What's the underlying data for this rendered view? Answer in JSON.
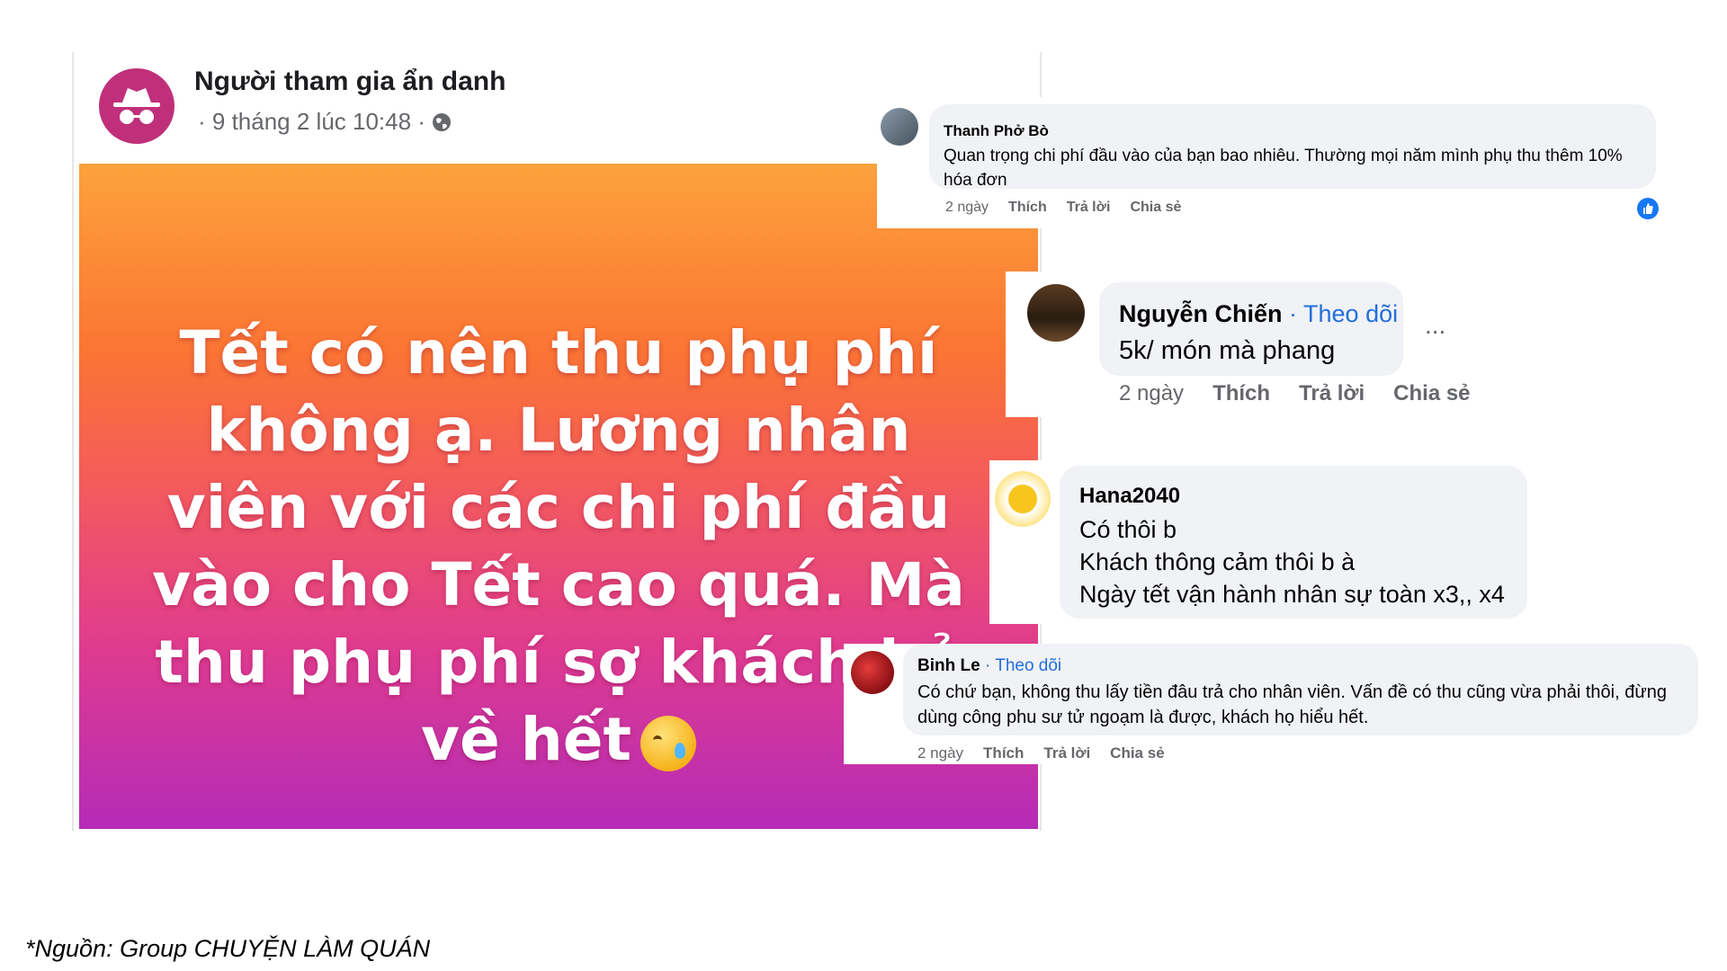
{
  "post": {
    "author": "Người tham gia ẩn danh",
    "meta": "· 9 tháng 2 lúc 10:48 ·",
    "text": "Tết có nên thu phụ phí không ạ. Lương nhân viên với các chi phí đầu vào cho Tết cao quá. Mà thu phụ phí sợ khách bỏ về hết",
    "gradient_colors": [
      "#fca23c",
      "#fb7533",
      "#f45b5b",
      "#e03c8e",
      "#b52bb7"
    ]
  },
  "comments": [
    {
      "name": "Thanh Phở Bò",
      "text": "Quan trọng chi phí đầu vào của bạn bao nhiêu. Thường mọi năm mình phụ thu thêm 10% hóa đơn",
      "time": "2 ngày",
      "like": "Thích",
      "reply": "Trả lời",
      "share": "Chia sẻ"
    },
    {
      "name": "Nguyễn Chiến",
      "follow": "· Theo dõi",
      "text": "5k/ món mà phang",
      "more": "...",
      "time": "2 ngày",
      "like": "Thích",
      "reply": "Trả lời",
      "share": "Chia sẻ"
    },
    {
      "name": "Hana2040",
      "lines": [
        "Có thôi b",
        "Khách thông cảm thôi b à",
        "Ngày tết vận hành nhân sự toàn x3,, x4"
      ]
    },
    {
      "name": "Binh Le",
      "follow": "· Theo dõi",
      "text": "Có chứ bạn, không thu lấy tiền đâu trả cho nhân viên. Vấn đề có thu cũng vừa phải thôi, đừng dùng công phu sư tử ngoạm là được, khách họ hiểu hết.",
      "time": "2 ngày",
      "like": "Thích",
      "reply": "Trả lời",
      "share": "Chia sẻ"
    }
  ],
  "source": "*Nguồn: Group CHUYỆN LÀM QUÁN"
}
